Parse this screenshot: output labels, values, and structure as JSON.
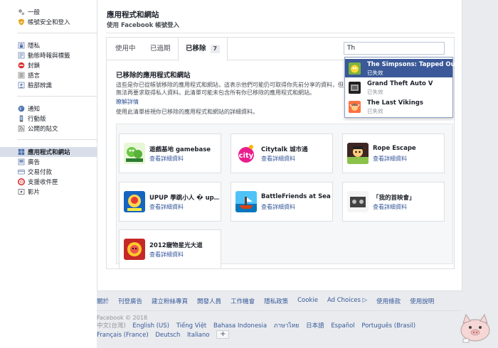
{
  "sidebar": {
    "groups": [
      [
        {
          "label": "一般",
          "icon": "gear-icon"
        },
        {
          "label": "帳號安全和登入",
          "icon": "shield-icon"
        }
      ],
      [
        {
          "label": "隱私",
          "icon": "lock-icon"
        },
        {
          "label": "動態時報與標籤",
          "icon": "timeline-icon"
        },
        {
          "label": "封鎖",
          "icon": "block-icon"
        },
        {
          "label": "語言",
          "icon": "language-icon"
        },
        {
          "label": "臉部辨識",
          "icon": "face-icon"
        }
      ],
      [
        {
          "label": "通知",
          "icon": "globe-icon"
        },
        {
          "label": "行動版",
          "icon": "mobile-icon"
        },
        {
          "label": "公開的貼文",
          "icon": "rss-icon"
        }
      ],
      [
        {
          "label": "應用程式和網站",
          "icon": "apps-icon",
          "active": true
        },
        {
          "label": "廣告",
          "icon": "ads-icon"
        },
        {
          "label": "交易付款",
          "icon": "payment-icon"
        },
        {
          "label": "支援收件匣",
          "icon": "support-icon"
        },
        {
          "label": "影片",
          "icon": "video-icon"
        }
      ]
    ]
  },
  "header": {
    "title": "應用程式和網站",
    "subtitle": "使用 Facebook 帳號登入"
  },
  "tabs": [
    {
      "label": "使用中"
    },
    {
      "label": "已過期"
    },
    {
      "label": "已移除",
      "count": "7",
      "active": true
    }
  ],
  "search": {
    "value": "Th"
  },
  "removed": {
    "title": "已移除的應用程式和網站",
    "description": "這些是你已從帳號移除的應用程式和網站，這表示他們可能仍可取得你先前分享的資料，但無法再要求取得私人資料。此清單可能未包含所有你已移除的應用程式和網站。",
    "learn_more": "瞭解詳情",
    "usage_note": "使用此清單檢視你已移除的應用程式和網站的詳細資料。"
  },
  "apps": [
    {
      "name": "遊戲基地 gamebase",
      "view": "查看詳細資料"
    },
    {
      "name": "Citytalk 城市通",
      "view": "查看詳細資料"
    },
    {
      "name": "Rope Escape",
      "view": "查看詳細資料"
    },
    {
      "name": "UPUP 學跳小人 � up…",
      "view": "查看詳細資料"
    },
    {
      "name": "BattleFriends at Sea",
      "view": "查看詳細資料"
    },
    {
      "name": "「我的首映會」",
      "view": "查看詳細資料"
    },
    {
      "name": "2012寵物星光大道",
      "view": "查看詳細資料"
    }
  ],
  "dropdown": [
    {
      "name": "The Simpsons: Tapped Out",
      "status": "已失效",
      "selected": true
    },
    {
      "name": "Grand Theft Auto V",
      "status": "已失效"
    },
    {
      "name": "The Last Vikings",
      "status": "已失效"
    }
  ],
  "footer": {
    "links": [
      "關於",
      "刊登廣告",
      "建立粉絲專頁",
      "開發人員",
      "工作機會",
      "隱私政策",
      "Cookie",
      "Ad Choices ▷",
      "使用條款",
      "使用說明"
    ],
    "copyright": "Facebook © 2018",
    "current_language": "中文(台灣)",
    "languages": [
      "English (US)",
      "Tiếng Việt",
      "Bahasa Indonesia",
      "ภาษาไทย",
      "日本語",
      "Español",
      "Português (Brasil)",
      "Français (France)",
      "Deutsch",
      "Italiano"
    ],
    "add_language": "+"
  }
}
